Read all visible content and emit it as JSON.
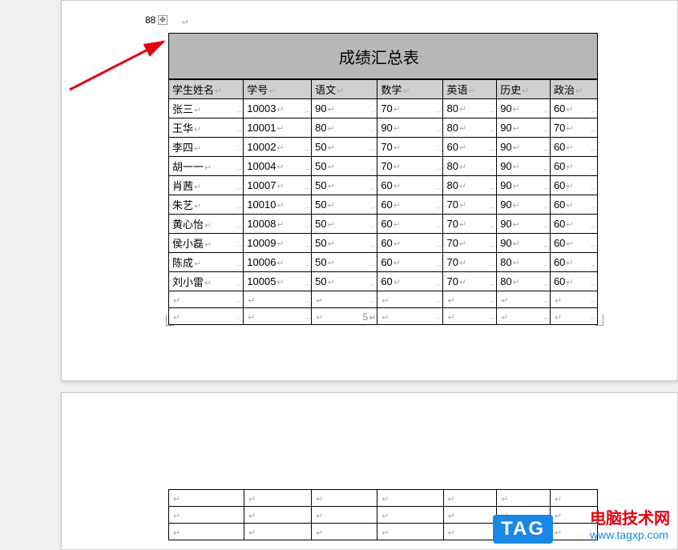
{
  "margin_label": "88",
  "page_num": "5",
  "table_title": "成绩汇总表",
  "headers": [
    "学生姓名",
    "学号",
    "语文",
    "数学",
    "英语",
    "历史",
    "政治"
  ],
  "rows": [
    [
      "张三",
      "10003",
      "90",
      "70",
      "80",
      "90",
      "60"
    ],
    [
      "王华",
      "10001",
      "80",
      "90",
      "80",
      "90",
      "70"
    ],
    [
      "李四",
      "10002",
      "50",
      "70",
      "60",
      "90",
      "60"
    ],
    [
      "胡一一",
      "10004",
      "50",
      "70",
      "80",
      "90",
      "60"
    ],
    [
      "肖茜",
      "10007",
      "50",
      "60",
      "80",
      "90",
      "60"
    ],
    [
      "朱艺",
      "10010",
      "50",
      "60",
      "70",
      "90",
      "60"
    ],
    [
      "黄心怡",
      "10008",
      "50",
      "60",
      "70",
      "90",
      "60"
    ],
    [
      "侯小磊",
      "10009",
      "50",
      "60",
      "70",
      "90",
      "60"
    ],
    [
      "陈成",
      "10006",
      "50",
      "60",
      "70",
      "80",
      "60"
    ],
    [
      "刘小雷",
      "10005",
      "50",
      "60",
      "70",
      "80",
      "60"
    ],
    [
      "",
      "",
      "",
      "",
      "",
      "",
      ""
    ],
    [
      "",
      "",
      "",
      "",
      "",
      "",
      ""
    ]
  ],
  "blank_rows": [
    [
      "",
      "",
      "",
      "",
      "",
      "",
      ""
    ],
    [
      "",
      "",
      "",
      "",
      "",
      "",
      ""
    ],
    [
      "",
      "",
      "",
      "",
      "",
      "",
      ""
    ]
  ],
  "watermark": {
    "tag": "TAG",
    "cn": "电脑技术网",
    "url": "www.tagxp.com"
  },
  "chart_data": {
    "type": "table",
    "title": "成绩汇总表",
    "columns": [
      "学生姓名",
      "学号",
      "语文",
      "数学",
      "英语",
      "历史",
      "政治"
    ],
    "rows": [
      {
        "学生姓名": "张三",
        "学号": "10003",
        "语文": 90,
        "数学": 70,
        "英语": 80,
        "历史": 90,
        "政治": 60
      },
      {
        "学生姓名": "王华",
        "学号": "10001",
        "语文": 80,
        "数学": 90,
        "英语": 80,
        "历史": 90,
        "政治": 70
      },
      {
        "学生姓名": "李四",
        "学号": "10002",
        "语文": 50,
        "数学": 70,
        "英语": 60,
        "历史": 90,
        "政治": 60
      },
      {
        "学生姓名": "胡一一",
        "学号": "10004",
        "语文": 50,
        "数学": 70,
        "英语": 80,
        "历史": 90,
        "政治": 60
      },
      {
        "学生姓名": "肖茜",
        "学号": "10007",
        "语文": 50,
        "数学": 60,
        "英语": 80,
        "历史": 90,
        "政治": 60
      },
      {
        "学生姓名": "朱艺",
        "学号": "10010",
        "语文": 50,
        "数学": 60,
        "英语": 70,
        "历史": 90,
        "政治": 60
      },
      {
        "学生姓名": "黄心怡",
        "学号": "10008",
        "语文": 50,
        "数学": 60,
        "英语": 70,
        "历史": 90,
        "政治": 60
      },
      {
        "学生姓名": "侯小磊",
        "学号": "10009",
        "语文": 50,
        "数学": 60,
        "英语": 70,
        "历史": 90,
        "政治": 60
      },
      {
        "学生姓名": "陈成",
        "学号": "10006",
        "语文": 50,
        "数学": 60,
        "英语": 70,
        "历史": 80,
        "政治": 60
      },
      {
        "学生姓名": "刘小雷",
        "学号": "10005",
        "语文": 50,
        "数学": 60,
        "英语": 70,
        "历史": 80,
        "政治": 60
      }
    ]
  }
}
